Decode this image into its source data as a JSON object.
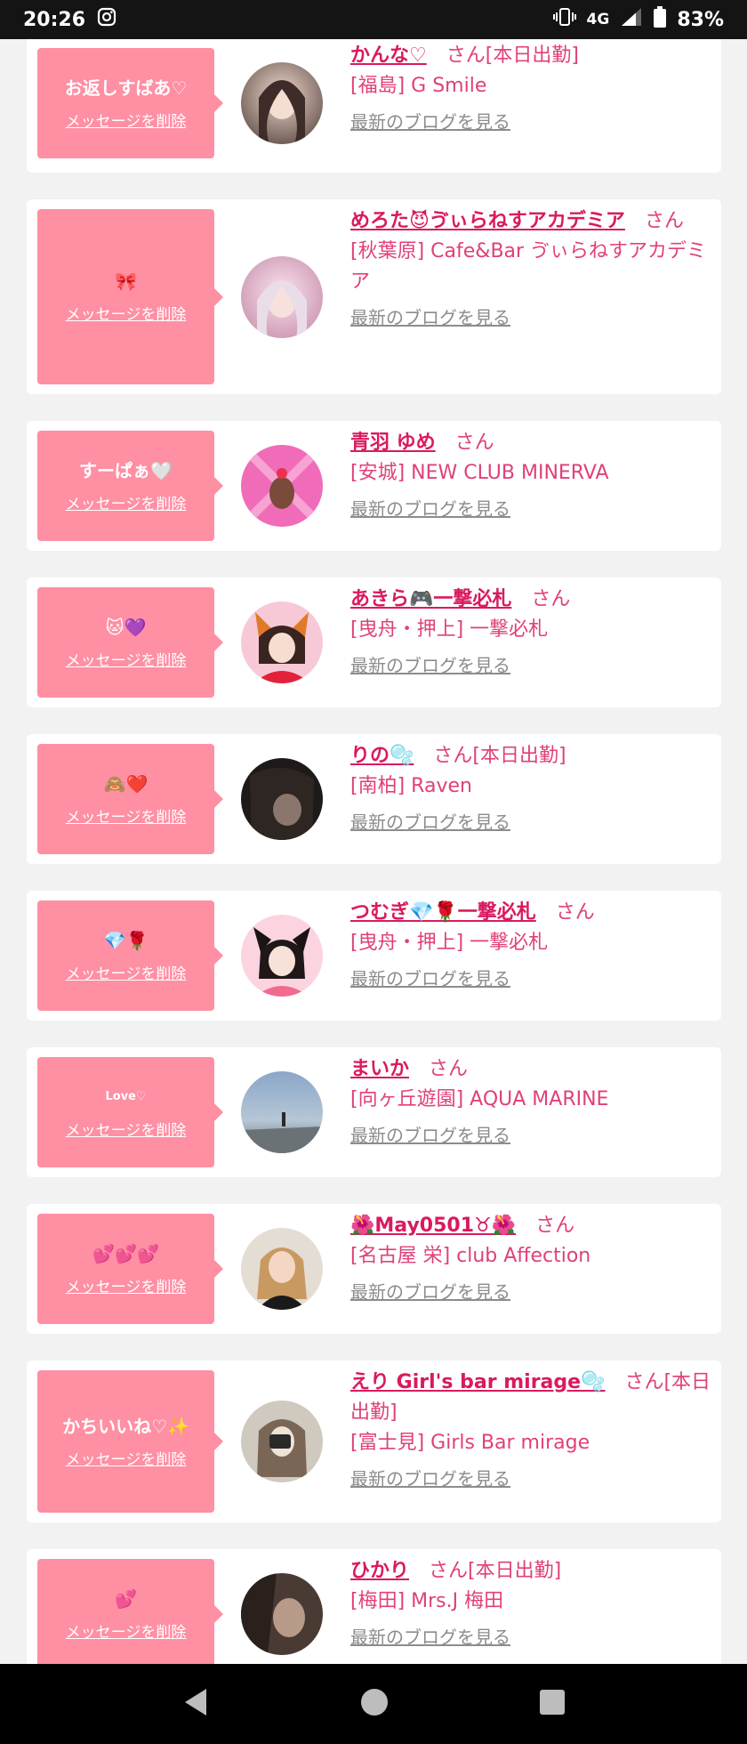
{
  "status_bar": {
    "time": "20:26",
    "network": "4G",
    "battery": "83%"
  },
  "common": {
    "delete_label": "メッセージを削除",
    "blog_label": "最新のブログを見る"
  },
  "cards": [
    {
      "message": "お返しすばあ♡",
      "name": "かんな♡",
      "suffix": "さん[本日出勤]",
      "shop": "[福島] G Smile"
    },
    {
      "message": "🎀",
      "name": "めろた😈ゔぃらねすアカデミア",
      "suffix": "さん",
      "shop": "[秋葉原] Cafe&Bar ゔぃらねすアカデミア"
    },
    {
      "message": "すーぱぁ🤍",
      "name": "青羽 ゆめ",
      "suffix": "さん",
      "shop": "[安城] NEW CLUB MINERVA"
    },
    {
      "message": "🐱💜",
      "name": "あきら🎮一撃必札",
      "suffix": "さん",
      "shop": "[曳舟・押上] 一撃必札"
    },
    {
      "message": "🙈❤️",
      "name": "りの🫧",
      "suffix": "さん[本日出勤]",
      "shop": "[南柏] Raven"
    },
    {
      "message": "💎🌹",
      "name": "つむぎ💎🌹一撃必札",
      "suffix": "さん",
      "shop": "[曳舟・押上] 一撃必札"
    },
    {
      "message": "Love♡",
      "name": "まいか",
      "suffix": "さん",
      "shop": "[向ヶ丘遊園] AQUA MARINE"
    },
    {
      "message": "💕💕💕",
      "name": "🌺May0501♉🌺",
      "suffix": "さん",
      "shop": "[名古屋 栄] club Affection"
    },
    {
      "message": "かちいいね♡✨",
      "name": "えり Girl's bar mirage🫧",
      "suffix": "さん[本日出勤]",
      "shop": "[富士見] Girls Bar mirage"
    },
    {
      "message": "💕",
      "name": "ひかり",
      "suffix": "さん[本日出勤]",
      "shop": "[梅田] Mrs.J 梅田"
    }
  ]
}
